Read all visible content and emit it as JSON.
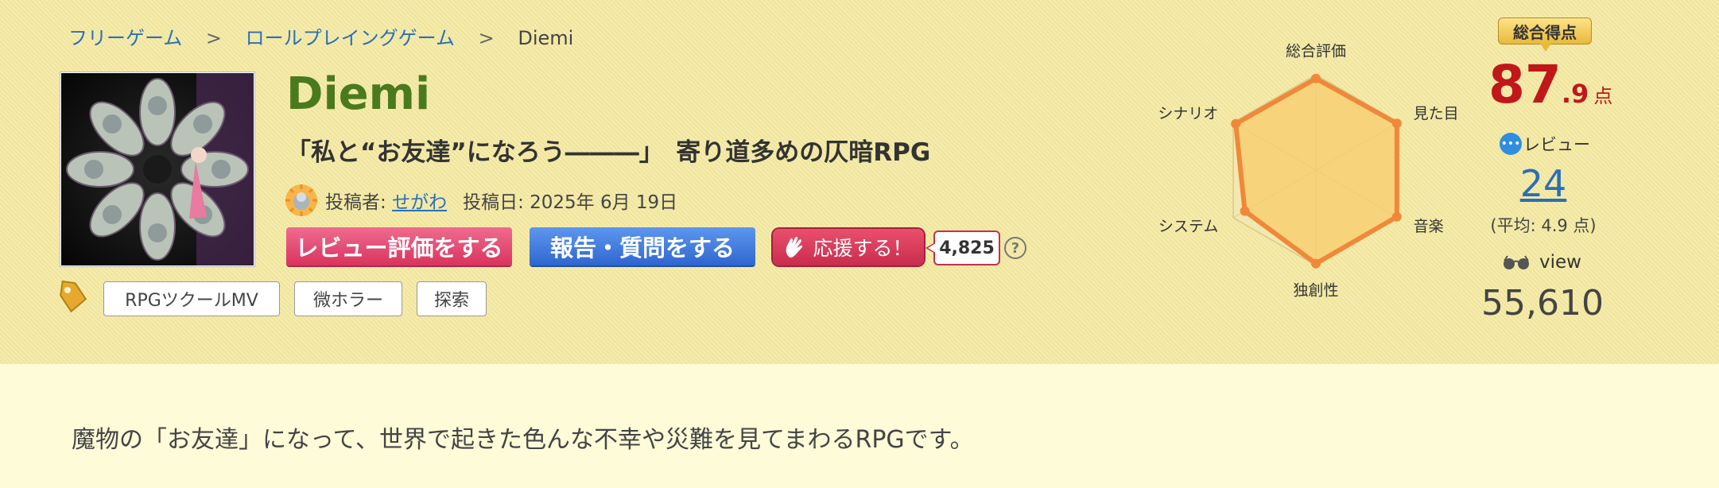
{
  "breadcrumb": {
    "items": [
      {
        "label": "フリーゲーム"
      },
      {
        "label": "ロールプレイングゲーム"
      }
    ],
    "separator": ">",
    "current": "Diemi"
  },
  "game": {
    "title": "Diemi",
    "catchphrase": "「私と“お友達”になろう―――」　寄り道多めの仄暗RPG",
    "poster_label": "投稿者:",
    "poster_name": "せがわ",
    "date_label": "投稿日:",
    "date_value": "2025年 6月 19日"
  },
  "actions": {
    "review_button": "レビュー評価をする",
    "report_button": "報告・質問をする",
    "support_button": "応援する！",
    "support_count": "4,825",
    "help_symbol": "?"
  },
  "tags": [
    "RPGツクールMV",
    "微ホラー",
    "探索"
  ],
  "radar": {
    "axes": [
      "総合評価",
      "見た目",
      "音楽",
      "独創性",
      "システム",
      "シナリオ"
    ],
    "values": [
      0.96,
      0.98,
      0.98,
      0.98,
      0.86,
      0.97
    ],
    "levels": 5,
    "fill_color": "#f8cc6b",
    "stroke_color": "#f0883a"
  },
  "score": {
    "badge": "総合得点",
    "integer": "87",
    "decimal": ".9",
    "unit": "点",
    "color": "#c0171b"
  },
  "reviews": {
    "label": "レビュー",
    "count": "24",
    "average": "(平均: 4.9 点)"
  },
  "views": {
    "label": "view",
    "count": "55,610"
  },
  "description": "魔物の「お友達」になって、世界で起きた色んな不幸や災難を見てまわるRPGです。"
}
